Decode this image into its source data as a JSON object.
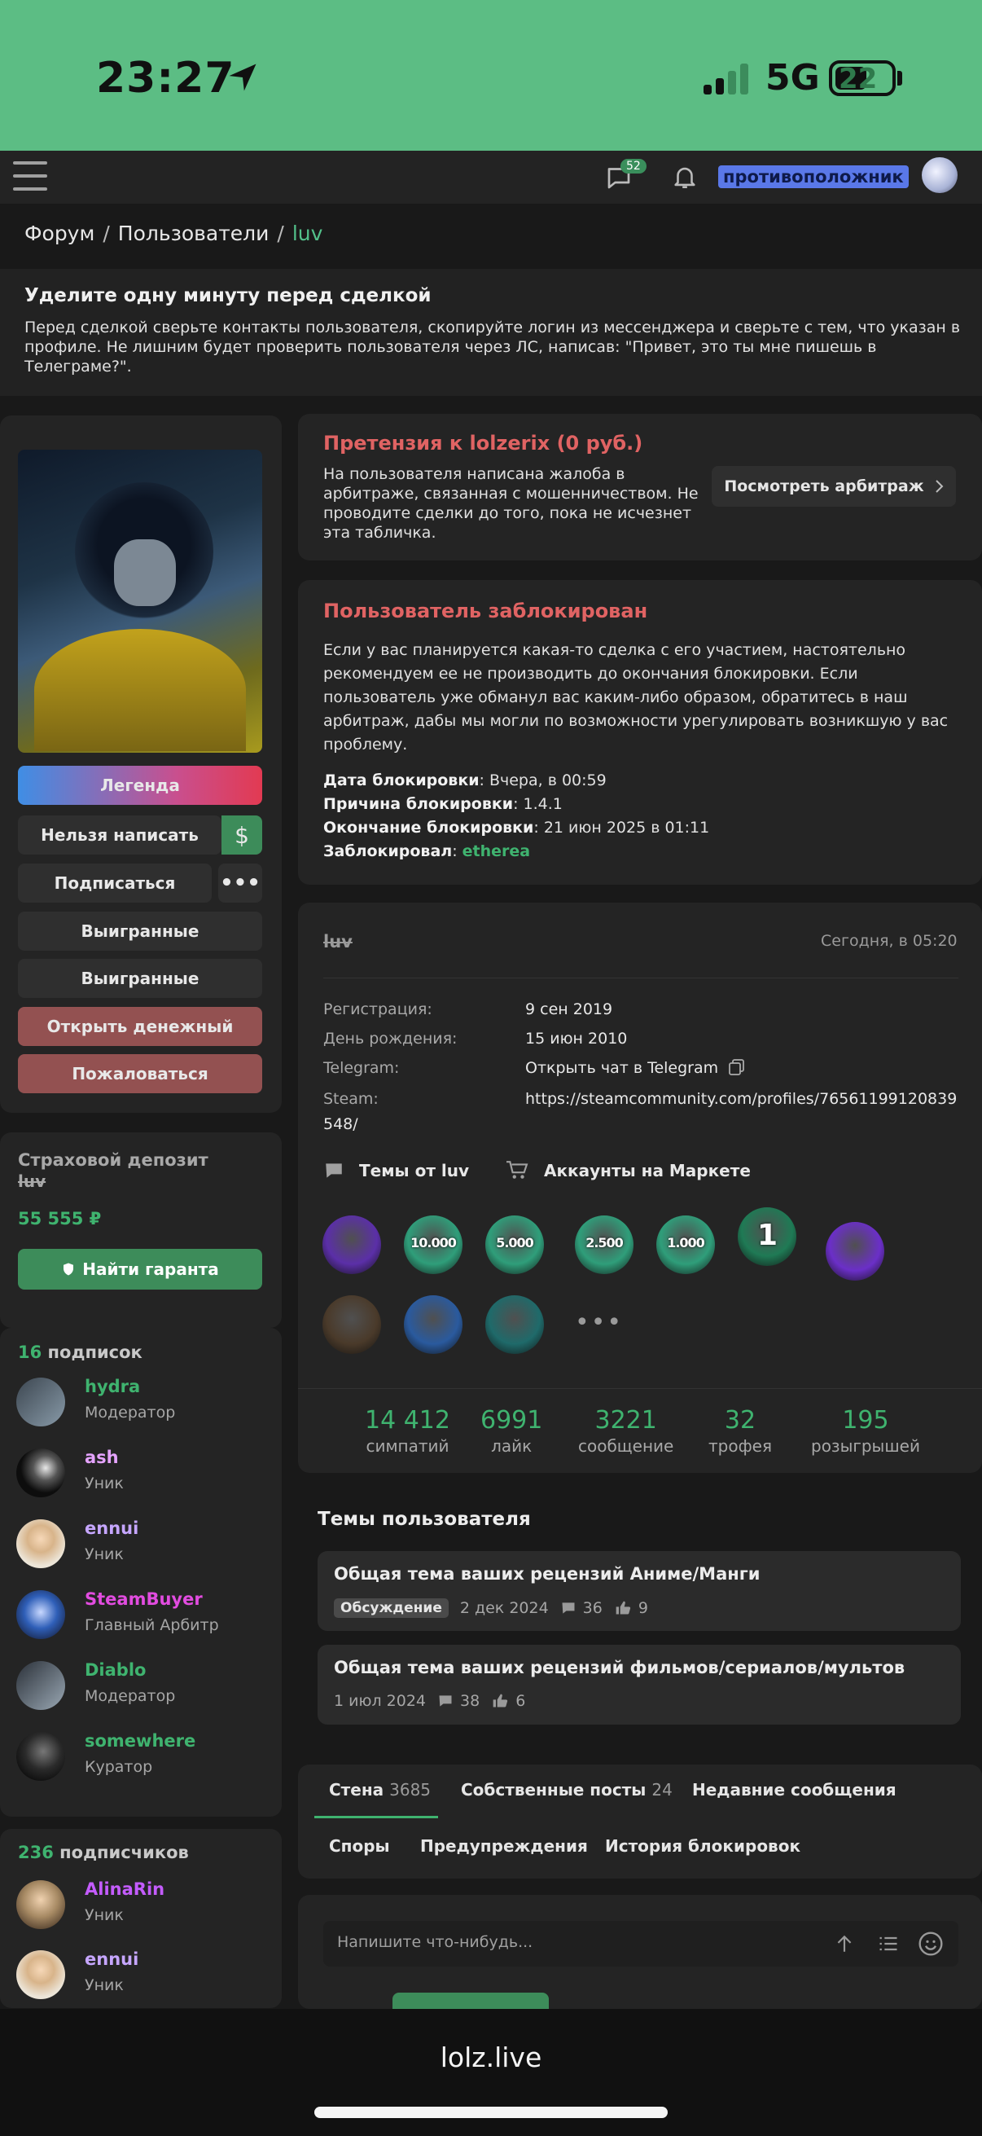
{
  "status_bar": {
    "time": "23:27",
    "network": "5G",
    "battery": "22"
  },
  "topnav": {
    "chat_badge": "52",
    "username": "противоположник"
  },
  "breadcrumb": {
    "forum": "Форум",
    "sep1": "/",
    "users": "Пользователи",
    "sep2": "/",
    "current": "luv"
  },
  "notice": {
    "title": "Уделите одну минуту перед сделкой",
    "text": "Перед сделкой сверьте контакты пользователя, скопируйте логин из мессенджера и сверьте с тем, что указан в профиле. Не лишним будет проверить пользователя через ЛС, написав: \"Привет, это ты мне пишешь в Телеграме?\"."
  },
  "left": {
    "legend": "Легенда",
    "cant_write": "Нельзя написать",
    "dollar": "$",
    "subscribe": "Подписаться",
    "more": "•••",
    "won1": "Выигранные",
    "won2": "Выигранные",
    "open_money": "Открыть денежный",
    "report": "Пожаловаться",
    "deposit_title": "Страховой депозит",
    "deposit_user": "luv",
    "deposit_amount": "55 555 ₽",
    "find_guarantor": "Найти гаранта",
    "subs_count": "16",
    "subs_label": "подписок",
    "subs": [
      {
        "name": "hydra",
        "role": "Модератор",
        "color": "#3fb36f"
      },
      {
        "name": "ash",
        "role": "Уник",
        "color": "#e5a3ff"
      },
      {
        "name": "ennui",
        "role": "Уник",
        "color": "#c6a6ff"
      },
      {
        "name": "SteamBuyer",
        "role": "Главный Арбитр",
        "color": "#e24ce0"
      },
      {
        "name": "Diablo",
        "role": "Модератор",
        "color": "#3fb36f"
      },
      {
        "name": "somewhere",
        "role": "Куратор",
        "color": "#3fb36f"
      }
    ],
    "followers_count": "236",
    "followers_label": "подписчиков",
    "followers": [
      {
        "name": "AlinaRin",
        "role": "Уник",
        "color": "#c45cff"
      },
      {
        "name": "ennui",
        "role": "Уник",
        "color": "#c6a6ff"
      }
    ]
  },
  "claim": {
    "title": "Претензия к lolzerix (0 руб.)",
    "text": "На пользователя написана жалоба в арбитраже, связанная с мошенничеством. Не проводите сделки до того, пока не исчезнет эта табличка.",
    "button": "Посмотреть арбитраж"
  },
  "blocked": {
    "title": "Пользователь заблокирован",
    "text": "Если у вас планируется какая-то сделка с его участием, настоятельно рекомендуем ее не производить до окончания блокировки. Если пользователь уже обманул вас каким-либо образом, обратитесь в наш арбитраж, дабы мы могли по возможности урегулировать возникшую у вас проблему.",
    "date_label": "Дата блокировки",
    "date_value": ": Вчера, в 00:59",
    "reason_label": "Причина блокировки",
    "reason_value": ": 1.4.1",
    "end_label": "Окончание блокировки",
    "end_value": ": 21 июн 2025 в 01:11",
    "by_label": "Заблокировал",
    "by_colon": ": ",
    "by_value": "etherea"
  },
  "info": {
    "username": "luv",
    "time": "Сегодня, в 05:20",
    "reg_label": "Регистрация:",
    "reg_value": "9 сен 2019",
    "bday_label": "День рождения:",
    "bday_value": "15 июн 2010",
    "tg_label": "Telegram:",
    "tg_value": "Открыть чат в Telegram",
    "steam_label": "Steam:",
    "steam_value1": "https://steamcommunity.com/profiles/76561199120839",
    "steam_value2": "548/",
    "themes_link": "Темы от luv",
    "accounts_link": "Аккаунты на Маркете",
    "badges": [
      {
        "label": "",
        "color": "#5b2fa8"
      },
      {
        "label": "10.000",
        "color": "#2f9e7a"
      },
      {
        "label": "5.000",
        "color": "#2f9e7a"
      },
      {
        "label": "2.500",
        "color": "#2f9e7a"
      },
      {
        "label": "1.000",
        "color": "#2f9e7a"
      },
      {
        "label": "1",
        "color": "#1f7a55"
      },
      {
        "label": "",
        "color": "#6b2fc8"
      },
      {
        "label": "",
        "color": "#4a3a2a"
      },
      {
        "label": "",
        "color": "#2a5a9e"
      },
      {
        "label": "",
        "color": "#1f6a6a"
      }
    ],
    "badges_more": "•••",
    "stats": [
      {
        "num": "14 412",
        "label": "симпатий"
      },
      {
        "num": "6991",
        "label": "лайк"
      },
      {
        "num": "3221",
        "label": "сообщение"
      },
      {
        "num": "32",
        "label": "трофея"
      },
      {
        "num": "195",
        "label": "розыгрышей"
      }
    ]
  },
  "themes": {
    "title": "Темы пользователя",
    "items": [
      {
        "title": "Общая тема ваших рецензий Аниме/Манги",
        "tag": "Обсуждение",
        "date": "2 дек 2024",
        "comments": "36",
        "likes": "9"
      },
      {
        "title": "Общая тема ваших рецензий фильмов/сериалов/мультов",
        "date": "1 июл 2024",
        "comments": "38",
        "likes": "6"
      }
    ]
  },
  "tabs": {
    "wall": "Стена",
    "wall_count": "3685",
    "own_posts": "Собственные посты",
    "own_count": "24",
    "recent": "Недавние сообщения",
    "disputes": "Споры",
    "warnings": "Предупреждения",
    "ban_history": "История блокировок"
  },
  "comment": {
    "placeholder": "Напишите что-нибудь..."
  },
  "browser": {
    "url": "lolz.live"
  }
}
